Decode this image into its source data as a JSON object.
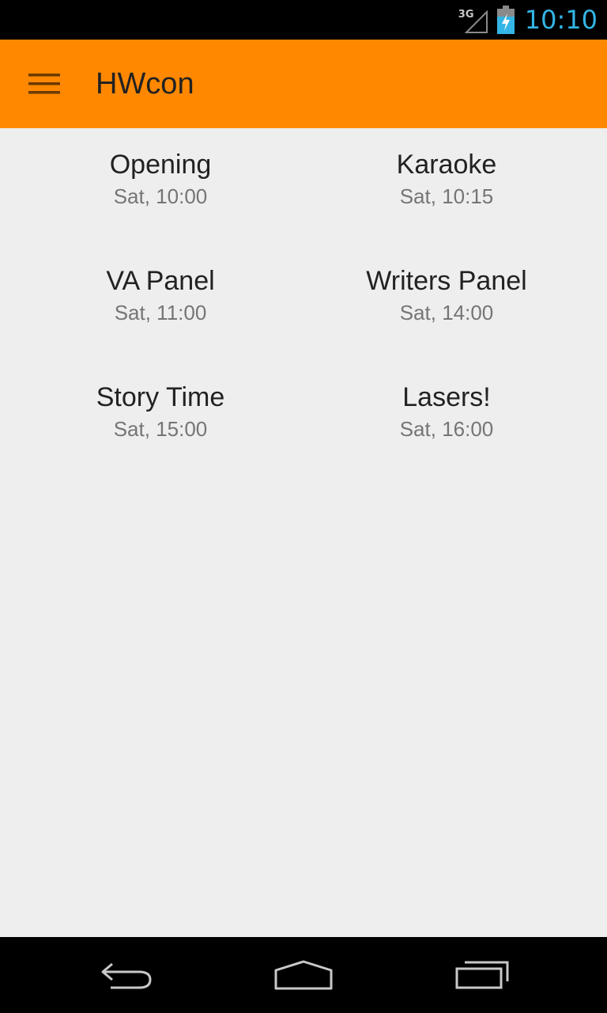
{
  "status_bar": {
    "network_label": "3G",
    "time": "10:10",
    "signal_icon": "signal-icon",
    "battery_icon": "battery-charging-icon",
    "clock_color": "#33b5e5"
  },
  "action_bar": {
    "title": "HWcon",
    "menu_icon": "hamburger-menu-icon",
    "background_color": "#ff8800"
  },
  "events": [
    {
      "title": "Opening",
      "time": "Sat, 10:00"
    },
    {
      "title": "Karaoke",
      "time": "Sat, 10:15"
    },
    {
      "title": "VA Panel",
      "time": "Sat, 11:00"
    },
    {
      "title": "Writers Panel",
      "time": "Sat, 14:00"
    },
    {
      "title": "Story Time",
      "time": "Sat, 15:00"
    },
    {
      "title": "Lasers!",
      "time": "Sat, 16:00"
    }
  ],
  "nav_bar": {
    "back_icon": "back-icon",
    "home_icon": "home-icon",
    "recents_icon": "recent-apps-icon"
  }
}
